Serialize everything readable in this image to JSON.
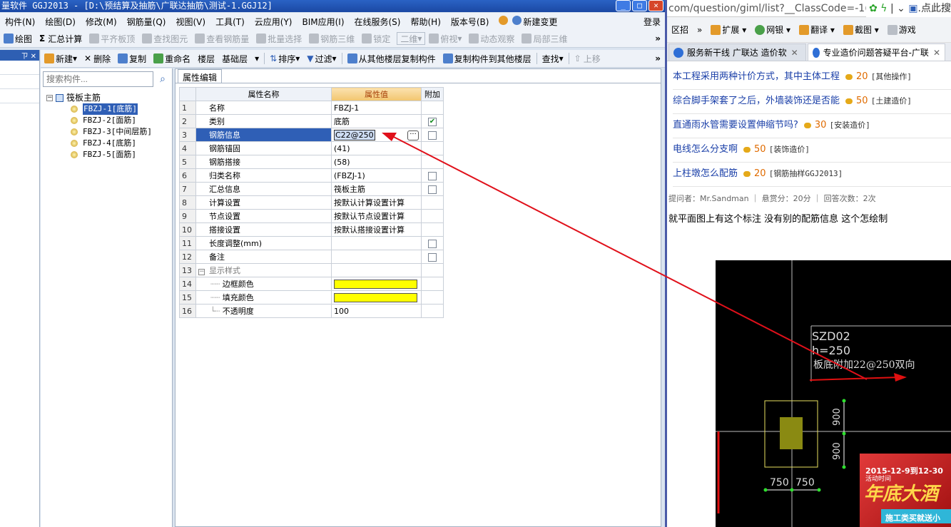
{
  "app": {
    "title": "量软件 GGJ2013 - [D:\\预结算及抽筋\\广联达抽筋\\测试-1.GGJ12]",
    "window_buttons": [
      "_",
      "□",
      "✕"
    ],
    "menu": [
      "构件(N)",
      "绘图(D)",
      "修改(M)",
      "钢筋量(Q)",
      "视图(V)",
      "工具(T)",
      "云应用(Y)",
      "BIM应用(I)",
      "在线服务(S)",
      "帮助(H)",
      "版本号(B)",
      "新建变更"
    ],
    "login": "登录",
    "toolbar1": [
      "绘图",
      "汇总计算",
      "平齐板顶",
      "查找图元",
      "查看钢筋量",
      "批量选择",
      "钢筋三维",
      "锁定",
      "二维",
      "俯视",
      "动态观察",
      "局部三维"
    ],
    "toolbar2": {
      "new": "新建",
      "delete": "删除",
      "copy": "复制",
      "rename": "重命名",
      "floor_label": "楼层",
      "floor_value": "基础层",
      "sort": "排序",
      "filter": "过滤",
      "copy_from": "从其他楼层复制构件",
      "copy_to": "复制构件到其他楼层",
      "find": "查找",
      "up": "上移"
    },
    "more": "»",
    "pin": "ㄗ ✕"
  },
  "tree": {
    "search_placeholder": "搜索构件...",
    "root": "筏板主筋",
    "items": [
      "FBZJ-1[底筋]",
      "FBZJ-2[面筋]",
      "FBZJ-3[中间层筋]",
      "FBZJ-4[底筋]",
      "FBZJ-5[面筋]"
    ]
  },
  "props": {
    "tab": "属性编辑",
    "headers": {
      "name": "属性名称",
      "value": "属性值",
      "add": "附加"
    },
    "rows": [
      {
        "i": "1",
        "name": "名称",
        "value": "FBZJ-1"
      },
      {
        "i": "2",
        "name": "类别",
        "value": "底筋"
      },
      {
        "i": "3",
        "name": "钢筋信息",
        "value": "C22@250"
      },
      {
        "i": "4",
        "name": "钢筋锚固",
        "value": "(41)"
      },
      {
        "i": "5",
        "name": "钢筋搭接",
        "value": "(58)"
      },
      {
        "i": "6",
        "name": "归类名称",
        "value": "(FBZJ-1)"
      },
      {
        "i": "7",
        "name": "汇总信息",
        "value": "筏板主筋"
      },
      {
        "i": "8",
        "name": "计算设置",
        "value": "按默认计算设置计算"
      },
      {
        "i": "9",
        "name": "节点设置",
        "value": "按默认节点设置计算"
      },
      {
        "i": "10",
        "name": "搭接设置",
        "value": "按默认搭接设置计算"
      },
      {
        "i": "11",
        "name": "长度调整(mm)",
        "value": ""
      },
      {
        "i": "12",
        "name": "备注",
        "value": ""
      },
      {
        "i": "13",
        "name": "显示样式",
        "value": ""
      },
      {
        "i": "14",
        "name": "边框颜色",
        "value": ""
      },
      {
        "i": "15",
        "name": "填充颜色",
        "value": ""
      },
      {
        "i": "16",
        "name": "不透明度",
        "value": "100"
      }
    ],
    "swatch_color": "#ffff00",
    "dots": "···"
  },
  "browser": {
    "address": "com/question/giml/list?__ClassCode=-1(",
    "address_right": "点此搜",
    "tools": [
      "区招",
      "»",
      "扩展",
      "网银",
      "翻译",
      "截图",
      "游戏"
    ],
    "tabs": [
      {
        "label": "服务新干线 广联达 造价软"
      },
      {
        "label": "专业造价问题答疑平台-广联"
      }
    ],
    "questions": [
      {
        "title": "本工程采用两种计价方式，其中主体工程",
        "points": "20",
        "cat": "[其他操作]"
      },
      {
        "title": "综合脚手架套了之后，外墙装饰还是否能",
        "points": "50",
        "cat": "[土建造价]"
      },
      {
        "title": "直通雨水管需要设置伸缩节吗?",
        "points": "30",
        "cat": "[安装造价]"
      },
      {
        "title": "电线怎么分支啊",
        "points": "50",
        "cat": "[装饰造价]"
      },
      {
        "title": "上柱墩怎么配筋",
        "points": "20",
        "cat": "[钢筋抽样GGJ2013]"
      }
    ],
    "meta": "提问者：Mr.Sandman  ｜  悬赏分：20分  ｜  回答次数：2次",
    "body": "就平面图上有这个标注 没有别的配筋信息 这个怎绘制",
    "cad": {
      "l1": "SZD02",
      "l2": "h=250",
      "l3": "板底附加22@250双向",
      "d1": "900",
      "d2": "900",
      "d3": "750",
      "d4": "750"
    },
    "promo": {
      "date": "2015-12-9到12-30",
      "act": "活动时间",
      "headline": "年底大酒",
      "sub": "施工类买就送小"
    }
  },
  "colors": {
    "arrow": "#e0101a",
    "selection": "#2f5fb6",
    "swatch": "#ffff00"
  }
}
